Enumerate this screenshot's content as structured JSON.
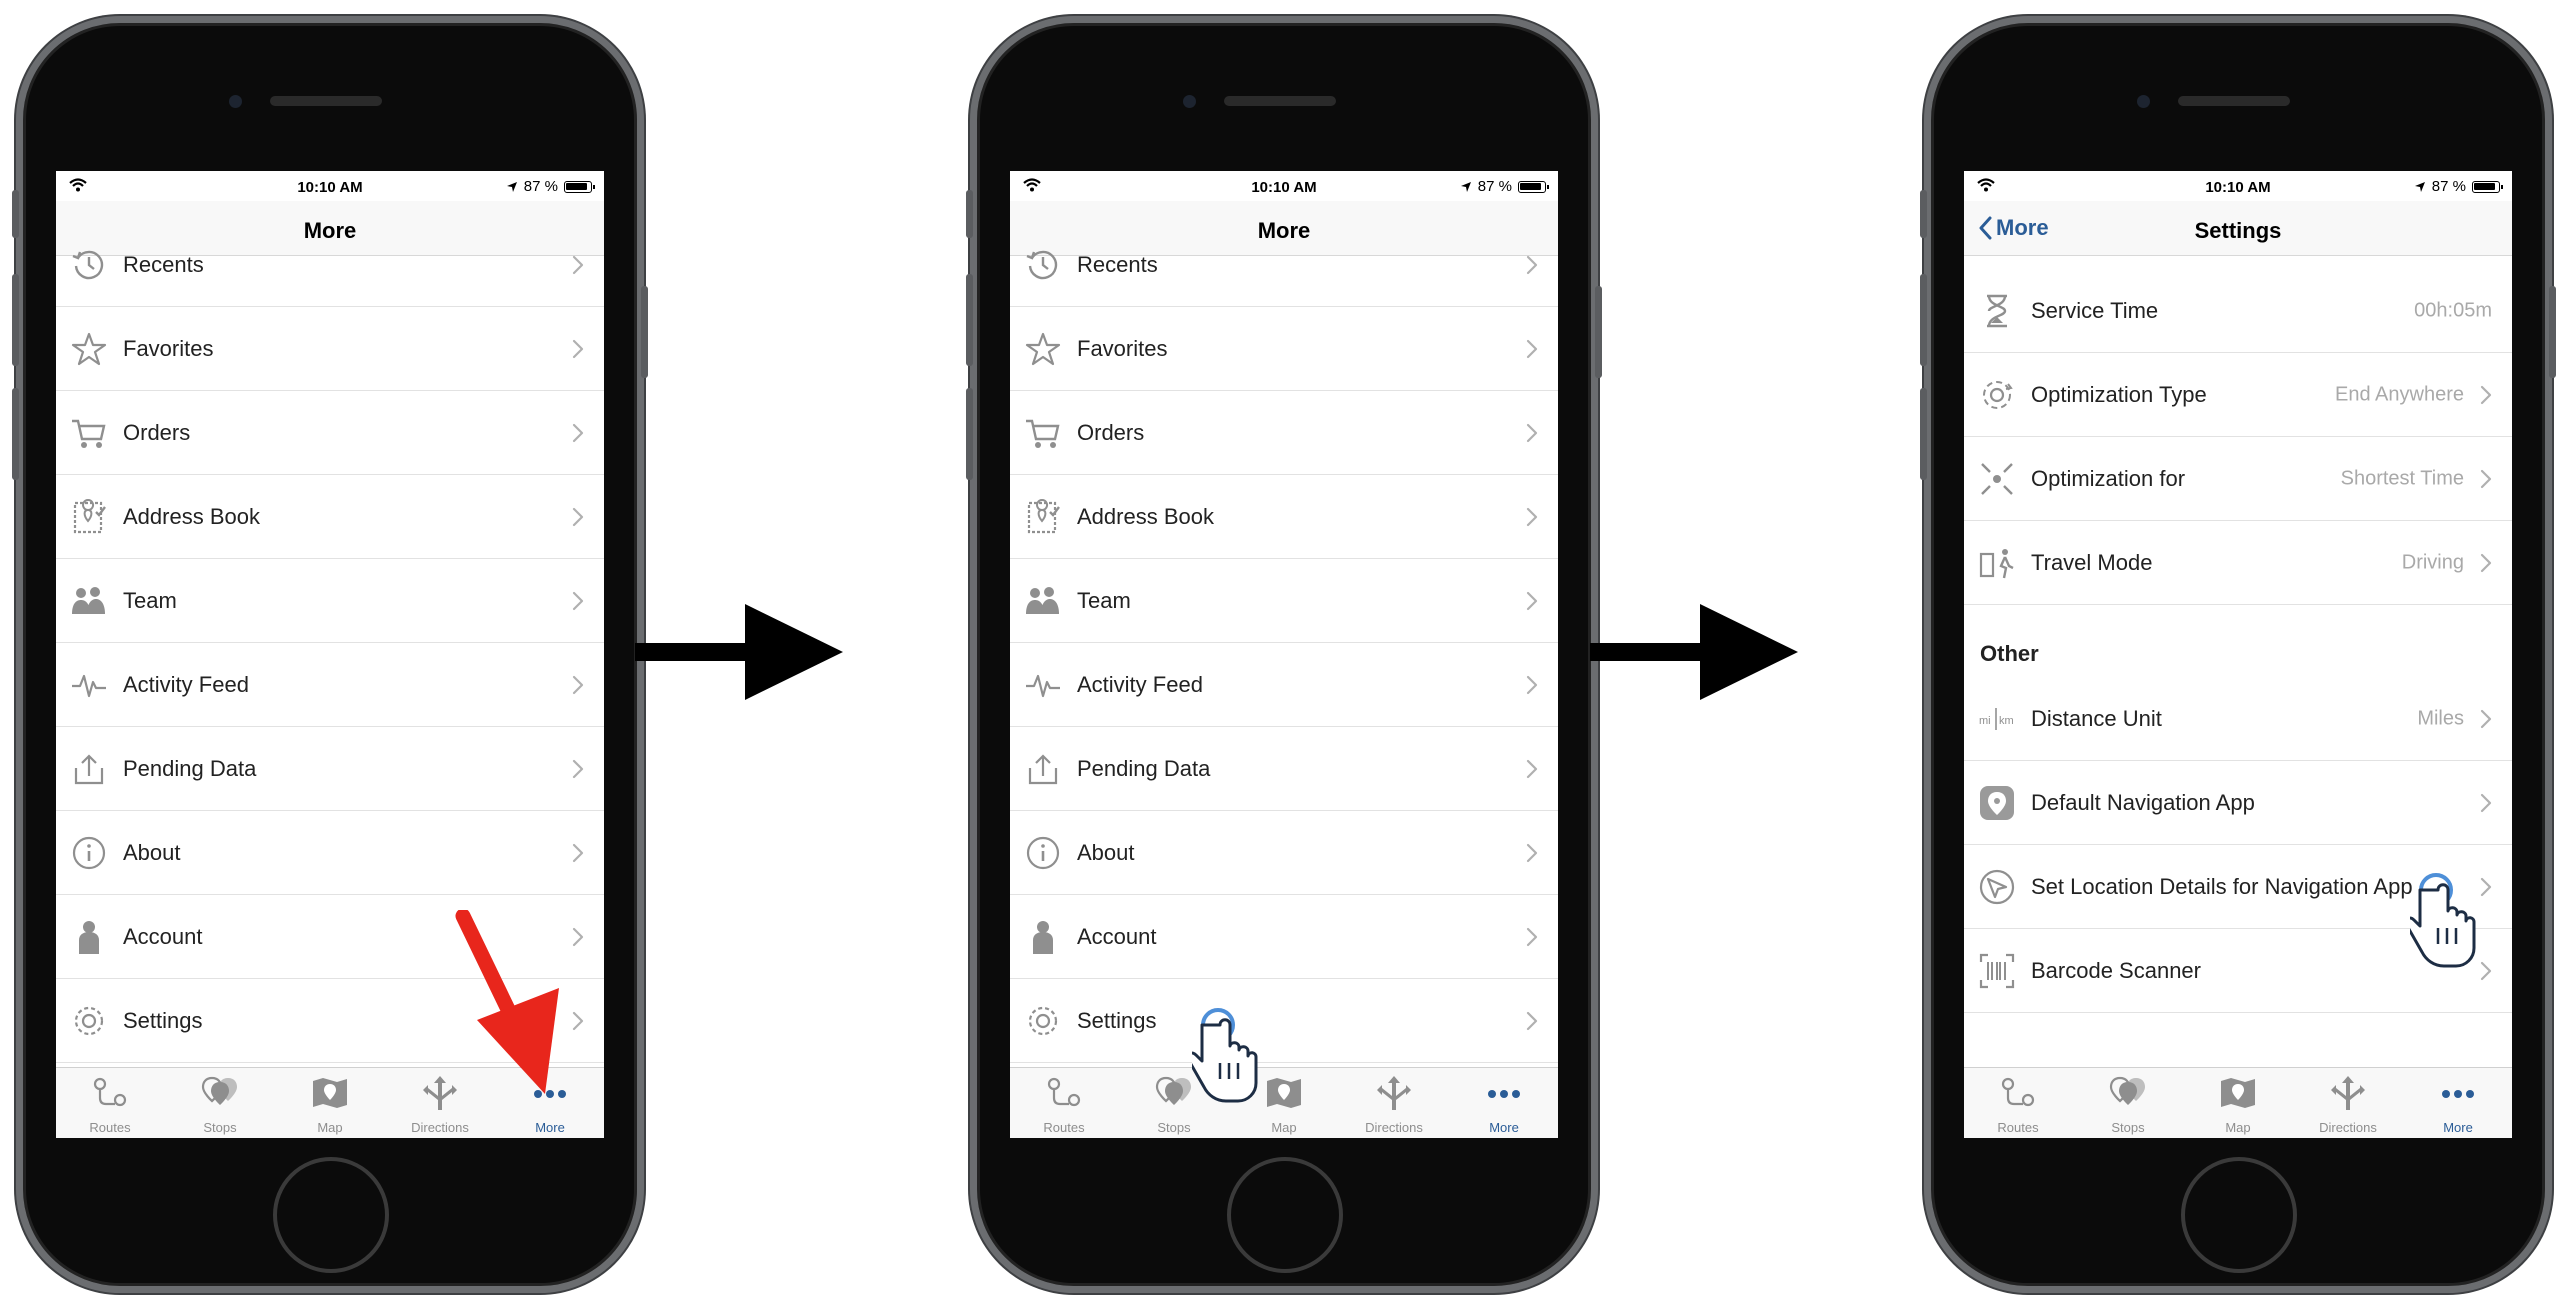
{
  "status_bar": {
    "time": "10:10 AM",
    "battery": "87 %"
  },
  "screen1": {
    "title": "More",
    "items": [
      "Recents",
      "Favorites",
      "Orders",
      "Address Book",
      "Team",
      "Activity Feed",
      "Pending Data",
      "About",
      "Account",
      "Settings"
    ]
  },
  "screen2": {
    "title": "More",
    "items": [
      "Recents",
      "Favorites",
      "Orders",
      "Address Book",
      "Team",
      "Activity Feed",
      "Pending Data",
      "About",
      "Account",
      "Settings"
    ]
  },
  "screen3": {
    "back_label": "More",
    "title": "Settings",
    "rows": [
      {
        "label": "Service Time",
        "value": "00h:05m"
      },
      {
        "label": "Optimization Type",
        "value": "End Anywhere"
      },
      {
        "label": "Optimization for",
        "value": "Shortest Time"
      },
      {
        "label": "Travel Mode",
        "value": "Driving"
      }
    ],
    "section": "Other",
    "other_rows": [
      {
        "label": "Distance Unit",
        "value": "Miles"
      },
      {
        "label": "Default Navigation App",
        "value": ""
      },
      {
        "label": "Set Location Details for Navigation App",
        "value": ""
      },
      {
        "label": "Barcode Scanner",
        "value": ""
      }
    ]
  },
  "tabs": [
    "Routes",
    "Stops",
    "Map",
    "Directions",
    "More"
  ],
  "colors": {
    "accent": "#2b5d97",
    "pointer_red": "#e8261c",
    "icon_gray": "#8f8f8f"
  }
}
